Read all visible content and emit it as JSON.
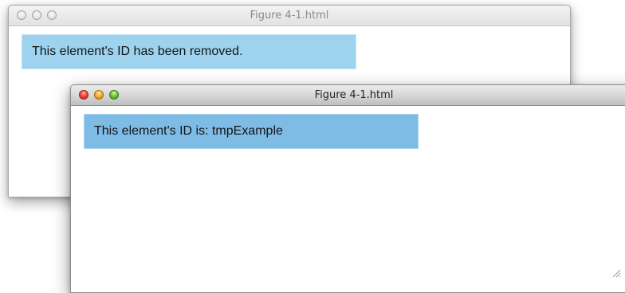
{
  "back_window": {
    "title": "Figure 4-1.html",
    "message": "This element's ID has been removed."
  },
  "front_window": {
    "title": "Figure 4-1.html",
    "message": "This element's ID is: tmpExample"
  },
  "colors": {
    "back_box": "#9ed3f0",
    "front_box": "#7ebce6",
    "close_light": "#ee4a3c",
    "minimize_light": "#f4b23a",
    "zoom_light": "#7cc43c"
  },
  "icons": {
    "resize": "resize-grip-icon"
  }
}
